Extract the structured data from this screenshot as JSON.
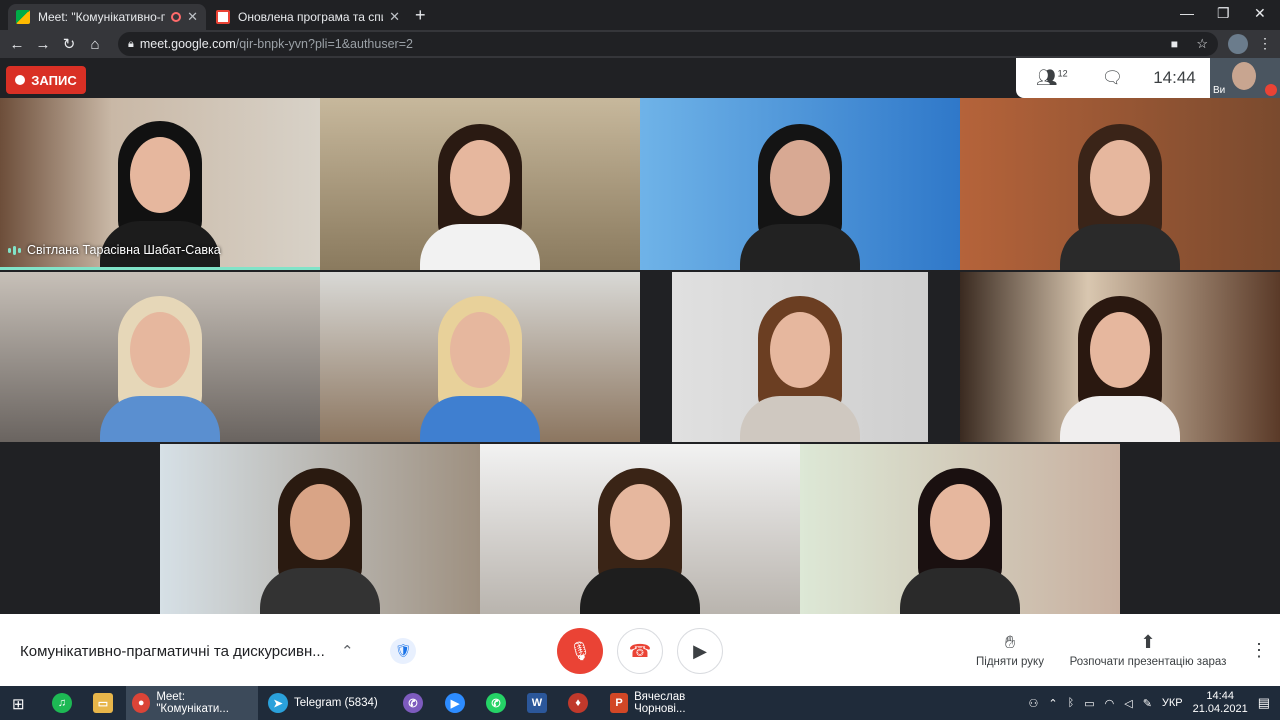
{
  "browser": {
    "tabs": [
      {
        "title": "Meet: \"Комунікативно-прагм",
        "active": true
      },
      {
        "title": "Оновлена програма та список",
        "active": false
      }
    ],
    "url_host": "meet.google.com",
    "url_path": "/qir-bnpk-yvn?pli=1&authuser=2"
  },
  "meet": {
    "recording_label": "ЗАПИС",
    "participants_count": "12",
    "time": "14:44",
    "self_label": "Ви",
    "speaker_name": "Світлана Тарасівна Шабат-Савка",
    "meeting_title": "Комунікативно-прагматичні та дискурсивн...",
    "raise_hand": "Підняти руку",
    "present_now": "Розпочати презентацію зараз"
  },
  "taskbar": {
    "items": [
      {
        "label": "Meet: \"Комунікати..."
      },
      {
        "label": "Telegram (5834)"
      },
      {
        "label": "Вячеслав Чорнові..."
      }
    ],
    "language": "УКР",
    "time": "14:44",
    "date": "21.04.2021"
  },
  "colors": {
    "record_red": "#d93025",
    "end_call_red": "#ea4335",
    "speaking_teal": "#81e3c8"
  }
}
